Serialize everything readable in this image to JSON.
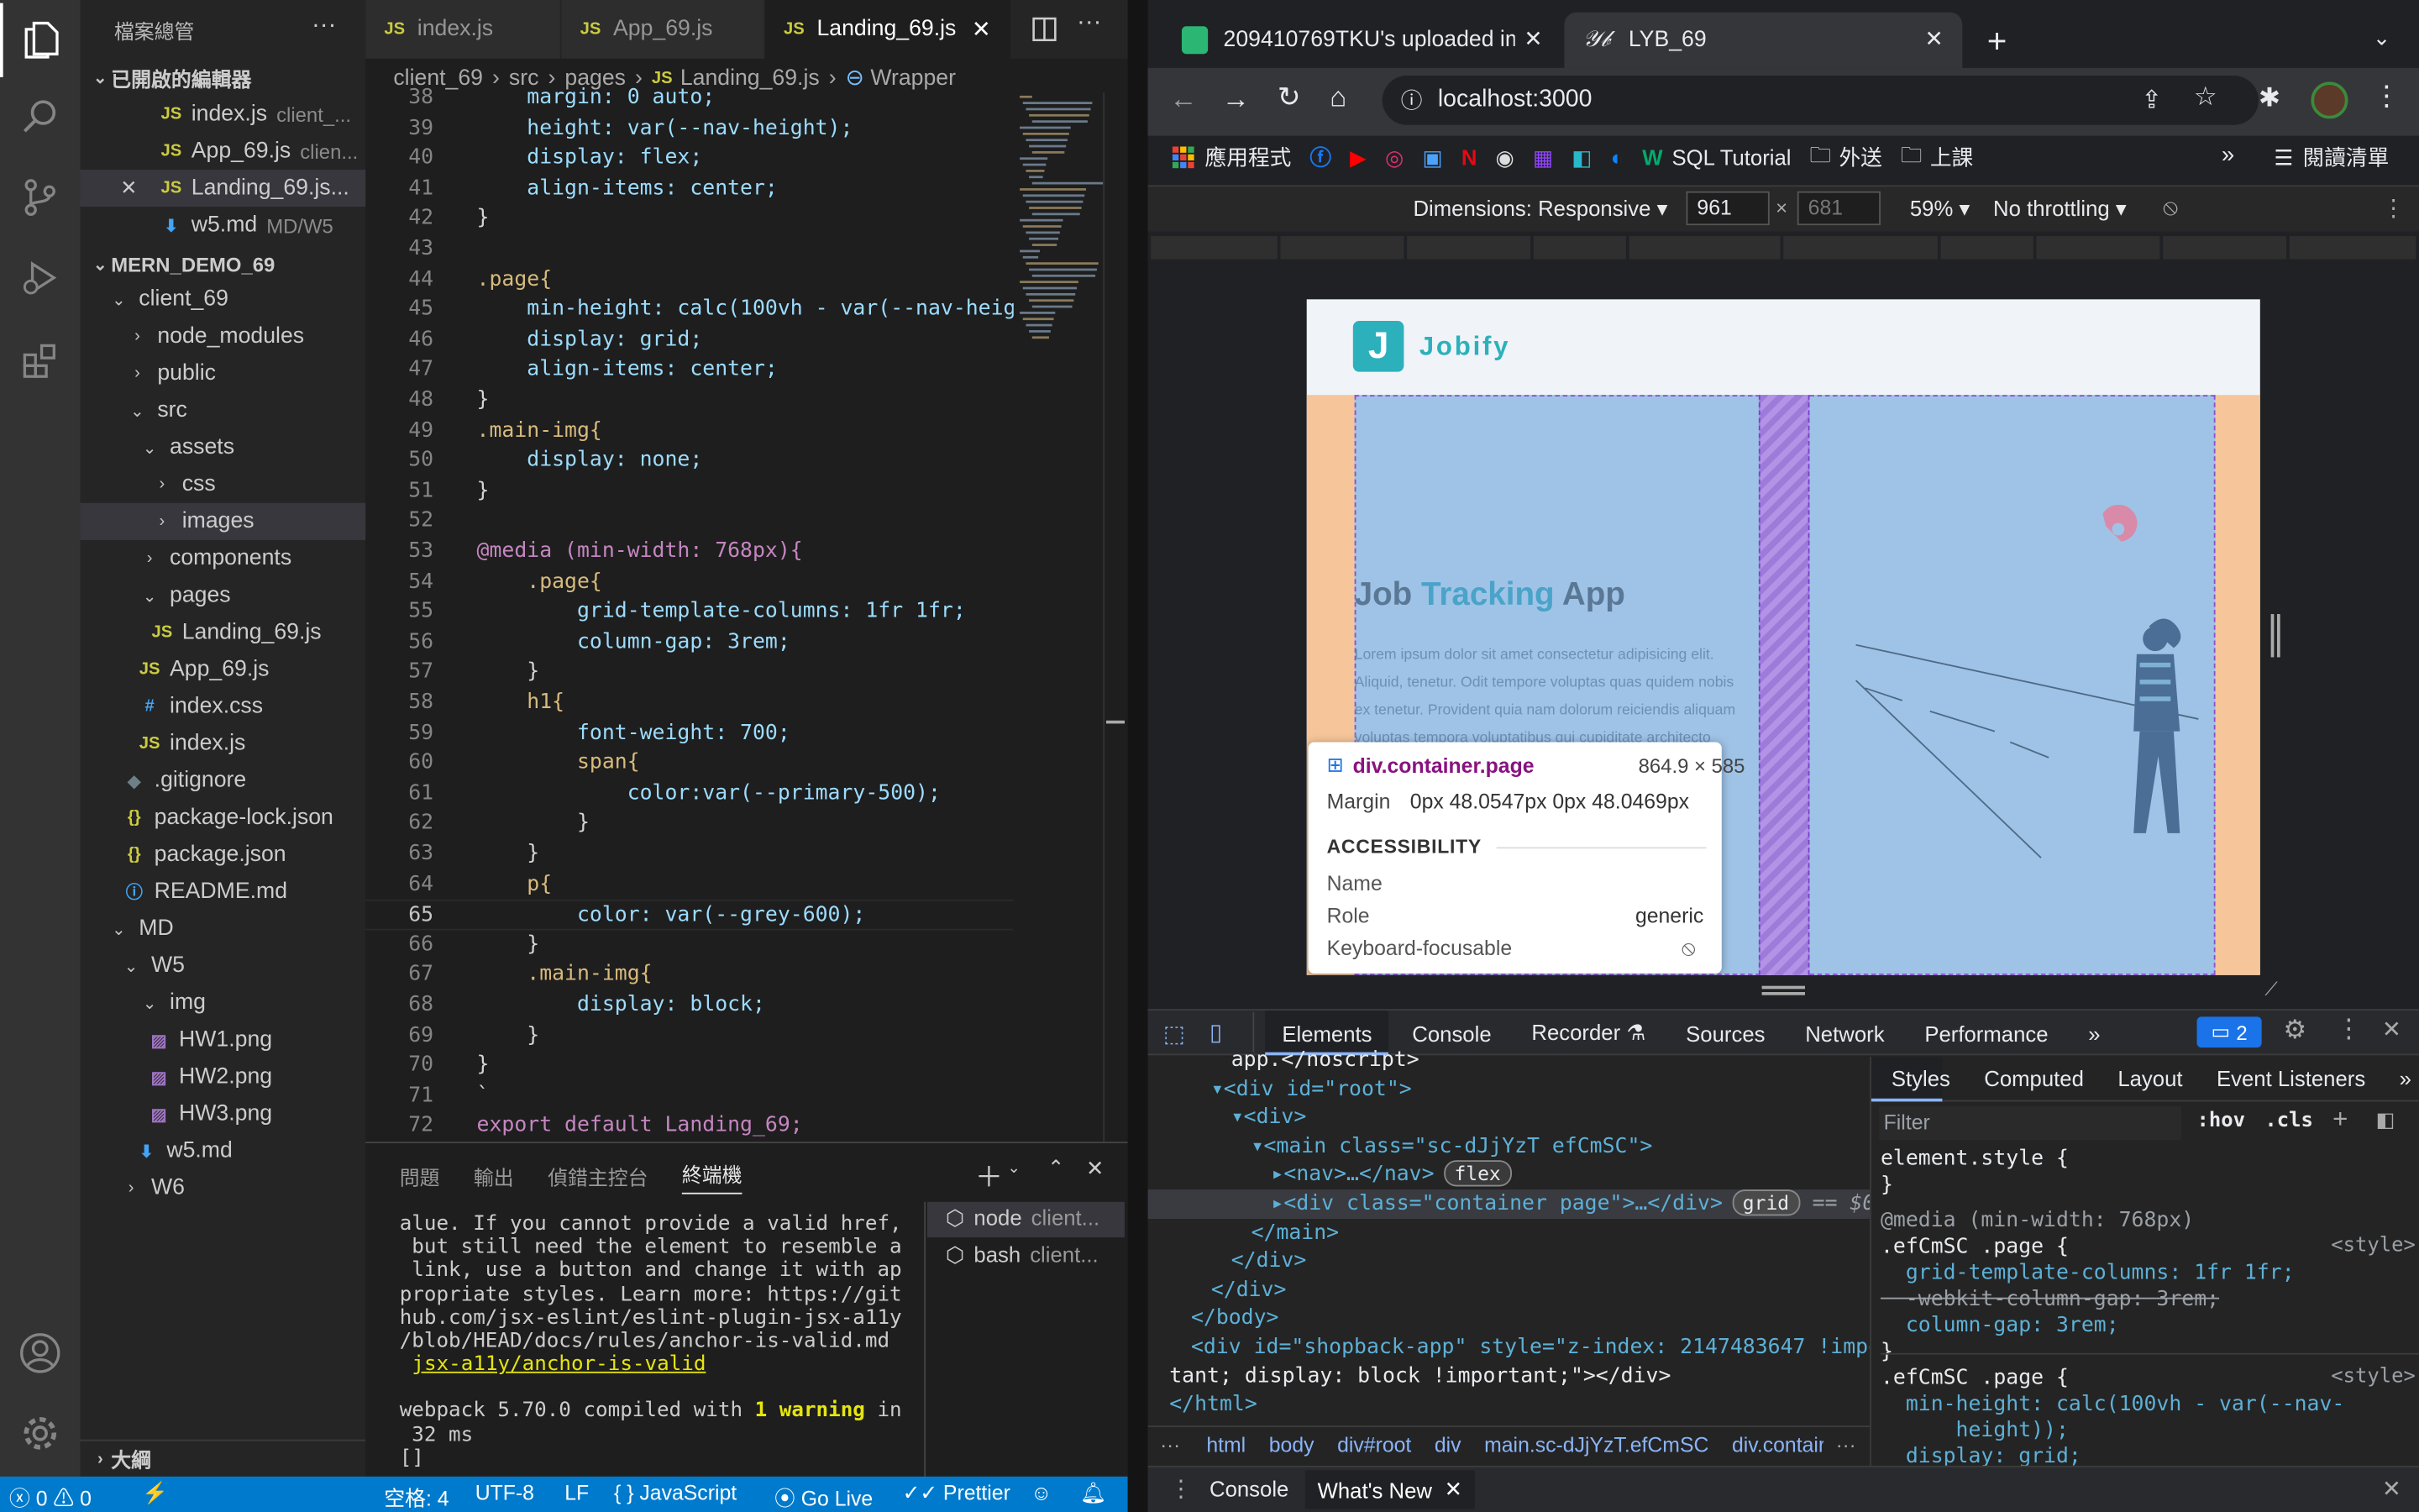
{
  "activity": {
    "items": [
      "files-icon",
      "search-icon",
      "source-control-icon",
      "run-debug-icon",
      "extensions-icon"
    ],
    "bottom": [
      "account-icon",
      "settings-gear-icon"
    ]
  },
  "sidebar": {
    "title": "檔案總管",
    "more": "···",
    "open_editors_title": "已開啟的編輯器",
    "open_editors": [
      {
        "name": "index.js",
        "desc": "client_..."
      },
      {
        "name": "App_69.js",
        "desc": "clien..."
      },
      {
        "name": "Landing_69.js...",
        "desc": ""
      },
      {
        "name": "w5.md",
        "desc": "MD/W5"
      }
    ],
    "project_title": "MERN_DEMO_69",
    "tree": [
      "client_69",
      "node_modules",
      "public",
      "src",
      "assets",
      "css",
      "images",
      "components",
      "pages",
      "Landing_69.js",
      "App_69.js",
      "index.css",
      "index.js",
      ".gitignore",
      "package-lock.json",
      "package.json",
      "README.md",
      "MD",
      "W5",
      "img",
      "HW1.png",
      "HW2.png",
      "HW3.png",
      "w5.md",
      "W6"
    ],
    "outline": "大綱"
  },
  "editor": {
    "tabs": [
      "index.js",
      "App_69.js",
      "Landing_69.js"
    ],
    "breadcrumb": [
      "client_69",
      "src",
      "pages",
      "Landing_69.js",
      "Wrapper"
    ],
    "lines": [
      {
        "n": "38",
        "t": "    margin: 0 auto;"
      },
      {
        "n": "39",
        "t": "    height: var(--nav-height);"
      },
      {
        "n": "40",
        "t": "    display: flex;"
      },
      {
        "n": "41",
        "t": "    align-items: center;"
      },
      {
        "n": "42",
        "t": "}"
      },
      {
        "n": "43",
        "t": ""
      },
      {
        "n": "44",
        "t": ".page{"
      },
      {
        "n": "45",
        "t": "    min-height: calc(100vh - var(--nav-heigh"
      },
      {
        "n": "46",
        "t": "    display: grid;"
      },
      {
        "n": "47",
        "t": "    align-items: center;"
      },
      {
        "n": "48",
        "t": "}"
      },
      {
        "n": "49",
        "t": ".main-img{"
      },
      {
        "n": "50",
        "t": "    display: none;"
      },
      {
        "n": "51",
        "t": "}"
      },
      {
        "n": "52",
        "t": ""
      },
      {
        "n": "53",
        "t": "@media (min-width: 768px){"
      },
      {
        "n": "54",
        "t": "    .page{"
      },
      {
        "n": "55",
        "t": "        grid-template-columns: 1fr 1fr;"
      },
      {
        "n": "56",
        "t": "        column-gap: 3rem;"
      },
      {
        "n": "57",
        "t": "    }"
      },
      {
        "n": "58",
        "t": "    h1{"
      },
      {
        "n": "59",
        "t": "        font-weight: 700;"
      },
      {
        "n": "60",
        "t": "        span{"
      },
      {
        "n": "61",
        "t": "            color:var(--primary-500);"
      },
      {
        "n": "62",
        "t": "        }"
      },
      {
        "n": "63",
        "t": "    }"
      },
      {
        "n": "64",
        "t": "    p{"
      },
      {
        "n": "65",
        "t": "        color: var(--grey-600);"
      },
      {
        "n": "66",
        "t": "    }"
      },
      {
        "n": "67",
        "t": "    .main-img{"
      },
      {
        "n": "68",
        "t": "        display: block;"
      },
      {
        "n": "69",
        "t": "    }"
      },
      {
        "n": "70",
        "t": "}"
      },
      {
        "n": "71",
        "t": "`"
      },
      {
        "n": "72",
        "t": "export default Landing_69;"
      }
    ],
    "active_line": "65"
  },
  "panel": {
    "tabs": [
      "問題",
      "輸出",
      "偵錯主控台",
      "終端機"
    ],
    "terminal": [
      "alue. If you cannot provide a valid href,",
      " but still need the element to resemble a",
      " link, use a button and change it with ap",
      "propriate styles. Learn more: https://git",
      "hub.com/jsx-eslint/eslint-plugin-jsx-a11y",
      "/blob/HEAD/docs/rules/anchor-is-valid.md"
    ],
    "terminal_link": "jsx-a11y/anchor-is-valid",
    "compiled_pre": "webpack 5.70.0 compiled with ",
    "compiled_warn": "1 warning",
    "compiled_post": " in",
    "compiled_time": " 32 ms",
    "prompt": "[]",
    "sessions": [
      {
        "name": "node",
        "desc": "client..."
      },
      {
        "name": "bash",
        "desc": "client..."
      }
    ]
  },
  "status": {
    "errors": "0",
    "warnings": "0",
    "spaces": "空格: 4",
    "encoding": "UTF-8",
    "eol": "LF",
    "lang": "JavaScript",
    "golive": "Go Live",
    "prettier": "Prettier"
  },
  "chrome": {
    "tabs": [
      "209410769TKU's uploaded im",
      "LYB_69"
    ],
    "url": "localhost:3000",
    "bookmarks": [
      "應用程式",
      "SQL Tutorial",
      "外送",
      "上課"
    ],
    "reading_list": "閱讀清單",
    "device": {
      "dimensions": "Dimensions: Responsive",
      "width": "961",
      "height": "681",
      "zoom": "59%",
      "throttle": "No throttling"
    }
  },
  "site": {
    "logo_letter": "J",
    "logo_text": "Jobify",
    "headline_1": "Job ",
    "headline_2": "Tracking",
    "headline_3": " App",
    "para": [
      "Lorem ipsum dolor sit amet consectetur adipisicing elit.",
      "Aliquid, tenetur. Odit tempore voluptas quas quidem nobis",
      "ex tenetur. Provident quia nam dolorum reiciendis aliquam",
      "voluptas tempora voluptatibus qui cupiditate architecto"
    ]
  },
  "inspect": {
    "selector": "div.container.page",
    "size": "864.9 × 585",
    "margin_label": "Margin",
    "margin_val": "0px 48.0547px 0px 48.0469px",
    "acc_title": "ACCESSIBILITY",
    "name_label": "Name",
    "role_label": "Role",
    "role_val": "generic",
    "kb_label": "Keyboard-focusable"
  },
  "devtools": {
    "tabs": [
      "Elements",
      "Console",
      "Recorder",
      "Sources",
      "Network",
      "Performance"
    ],
    "issues": "2",
    "dom": [
      {
        "i": 2,
        "h": "app.</noscript>"
      },
      {
        "i": 1,
        "h": "▾<div id=\"root\">"
      },
      {
        "i": 2,
        "h": "▾<div>"
      },
      {
        "i": 3,
        "h": "▾<main class=\"sc-dJjYzT efCmSC\">"
      },
      {
        "i": 4,
        "h": "▸<nav>…</nav>"
      },
      {
        "i": 4,
        "h": "▸<div class=\"container page\">…</div>"
      },
      {
        "i": 3,
        "h": "</main>"
      },
      {
        "i": 2,
        "h": "</div>"
      },
      {
        "i": 1,
        "h": "</div>"
      },
      {
        "i": 0,
        "h": "</body>"
      },
      {
        "i": 0,
        "h": "<div id=\"shopback-app\" style=\"z-index: 2147483647 !impor"
      },
      {
        "i": -1,
        "h": "tant; display: block !important;\"></div>"
      },
      {
        "i": -1,
        "h": "</html>"
      }
    ],
    "badge_flex": "flex",
    "badge_grid": "grid",
    "eq": "== $0",
    "crumbs": [
      "html",
      "body",
      "div#root",
      "div",
      "main.sc-dJjYzT.efCmSC",
      "div.contair"
    ],
    "style_tabs": [
      "Styles",
      "Computed",
      "Layout",
      "Event Listeners"
    ],
    "filter": "Filter",
    "hov": ":hov",
    ".cls": ".cls",
    "styles": [
      "element.style {",
      "}",
      "@media (min-width: 768px)",
      ".efCmSC .page {",
      "  grid-template-columns: 1fr 1fr;",
      "  -webkit-column-gap: 3rem;",
      "  column-gap: 3rem;",
      "}",
      ".efCmSC .page {",
      "  min-height: calc(100vh - var(--nav-",
      "      height));",
      "  display: grid;"
    ],
    "style_src": "<style>",
    "drawer": [
      "Console",
      "What's New"
    ]
  }
}
